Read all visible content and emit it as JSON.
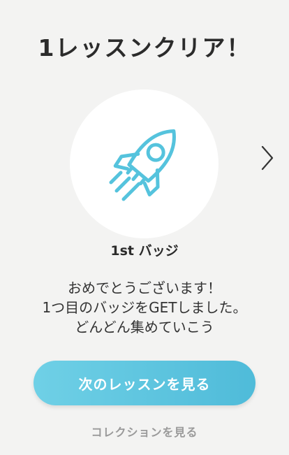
{
  "header": {
    "title": "1レッスンクリア！"
  },
  "badge": {
    "icon": "rocket-icon",
    "name": "1st バッジ",
    "accent_color": "#55c3dd"
  },
  "message": {
    "lines": [
      "おめでとうございます！",
      "1つ目のバッジをGETしました。",
      "どんどん集めていこう"
    ]
  },
  "actions": {
    "next_lesson_label": "次のレッスンを見る",
    "collection_label": "コレクションを見る",
    "next_badge_icon": "chevron-right-icon"
  }
}
